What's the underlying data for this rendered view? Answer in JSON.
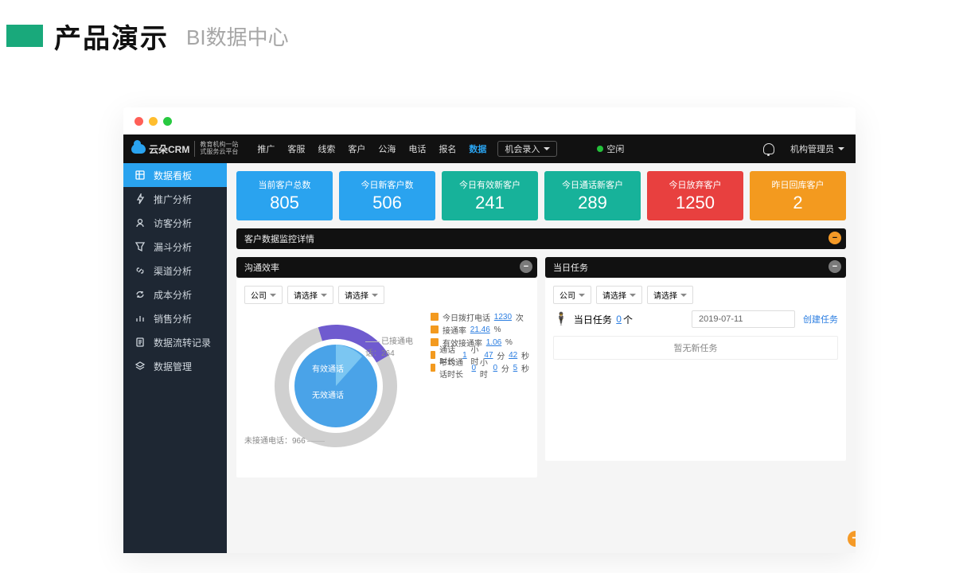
{
  "page": {
    "title": "产品演示",
    "subtitle": "BI数据中心"
  },
  "appbar": {
    "logo_main": "云朵CRM",
    "logo_sub1": "教育机构一站",
    "logo_sub2": "式服务云平台",
    "nav": [
      {
        "k": "promo",
        "label": "推广"
      },
      {
        "k": "service",
        "label": "客服"
      },
      {
        "k": "leads",
        "label": "线索"
      },
      {
        "k": "customers",
        "label": "客户"
      },
      {
        "k": "sea",
        "label": "公海"
      },
      {
        "k": "calls",
        "label": "电话"
      },
      {
        "k": "signup",
        "label": "报名"
      },
      {
        "k": "data",
        "label": "数据",
        "active": true
      },
      {
        "k": "opp",
        "label": "机会录入",
        "special": true
      }
    ],
    "status": "空闲",
    "user": "机构管理员"
  },
  "sidebar": {
    "items": [
      {
        "k": "dashboard",
        "label": "数据看板",
        "icon": "dashboard",
        "active": true
      },
      {
        "k": "promo",
        "label": "推广分析",
        "icon": "bolt"
      },
      {
        "k": "visitor",
        "label": "访客分析",
        "icon": "user"
      },
      {
        "k": "funnel",
        "label": "漏斗分析",
        "icon": "funnel"
      },
      {
        "k": "channel",
        "label": "渠道分析",
        "icon": "link"
      },
      {
        "k": "cost",
        "label": "成本分析",
        "icon": "refresh"
      },
      {
        "k": "sales",
        "label": "销售分析",
        "icon": "bars"
      },
      {
        "k": "flow",
        "label": "数据流转记录",
        "icon": "doc"
      },
      {
        "k": "manage",
        "label": "数据管理",
        "icon": "layers"
      }
    ]
  },
  "cards": [
    {
      "label": "当前客户总数",
      "value": "805",
      "color": "#2aa3ef"
    },
    {
      "label": "今日新客户数",
      "value": "506",
      "color": "#2aa3ef"
    },
    {
      "label": "今日有效新客户",
      "value": "241",
      "color": "#17b29a"
    },
    {
      "label": "今日通话新客户",
      "value": "289",
      "color": "#17b29a"
    },
    {
      "label": "今日放弃客户",
      "value": "1250",
      "color": "#e8403f"
    },
    {
      "label": "昨日回库客户",
      "value": "2",
      "color": "#f39a1f"
    }
  ],
  "bars": {
    "monitor": "客户数据监控详情",
    "comm": "沟通效率",
    "task": "当日任务"
  },
  "filters": {
    "company": "公司",
    "select": "请选择"
  },
  "comm": {
    "metrics": {
      "row1_pre": "今日拨打电话",
      "row1_num": "1230",
      "row1_suf": "次",
      "row2_pre": "接通率",
      "row2_num": "21.46",
      "row2_suf": "%",
      "row3_pre": "有效接通率",
      "row3_num": "1.06",
      "row3_suf": "%",
      "row4_pre": "通话时长",
      "row4_h": "1",
      "row4_hu": "小时",
      "row4_m": "47",
      "row4_mu": "分",
      "row4_s": "42",
      "row4_su": "秒",
      "row5_pre": "平均通话时长",
      "row5_h": "0",
      "row5_m": "0",
      "row5_s": "5"
    },
    "donut_inner1": "有效通话",
    "donut_inner2": "无效通话",
    "callout_missed_label": "未接通电话：",
    "callout_missed_val": "966",
    "callout_conn_label": "已接通电话：",
    "callout_conn_val": "264",
    "chart_data": {
      "type": "pie",
      "title": "沟通效率",
      "series": [
        {
          "name": "未接通电话",
          "value": 966,
          "color": "#d0d0d0"
        },
        {
          "name": "已接通电话",
          "value": 264,
          "color": "#6f5bcf"
        },
        {
          "name": "有效通话",
          "value": 13,
          "color": "#4aa3e8"
        },
        {
          "name": "无效通话",
          "value": 251,
          "color": "#4aa3e8"
        }
      ],
      "total_calls": 1230
    }
  },
  "task": {
    "title": "当日任务",
    "count": "0",
    "count_suf": "个",
    "date": "2019-07-11",
    "create": "创建任务",
    "empty": "暂无新任务"
  }
}
